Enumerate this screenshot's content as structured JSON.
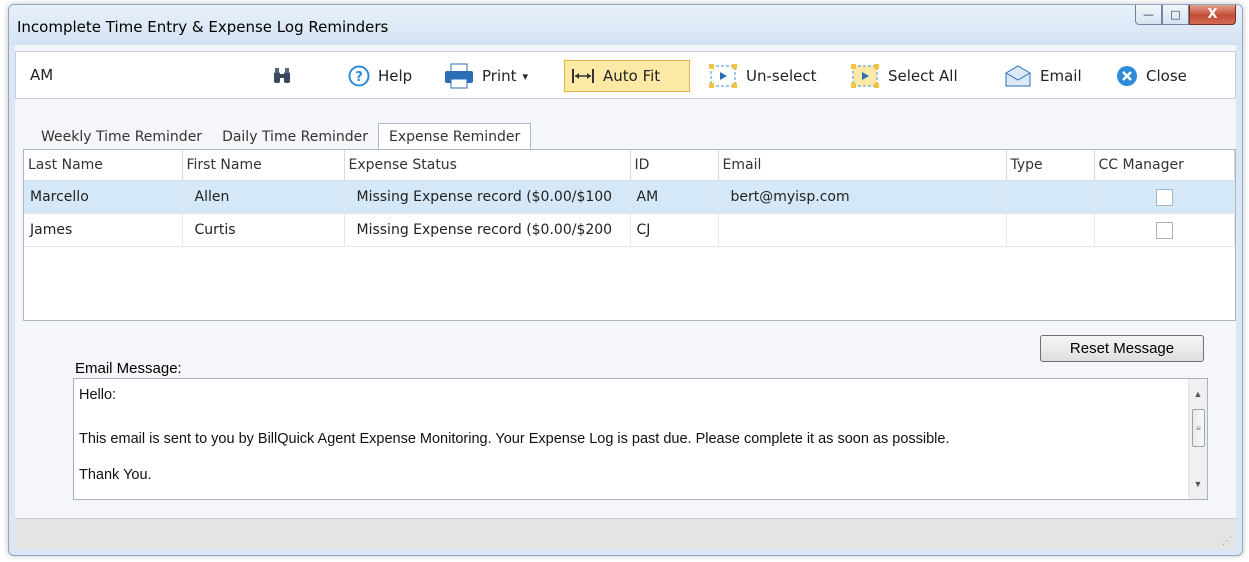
{
  "window": {
    "title": "Incomplete Time Entry & Expense Log Reminders",
    "controls": {
      "minimize": "—",
      "maximize": "□",
      "close": "X"
    }
  },
  "toolbar": {
    "search_value": "AM",
    "help_label": "Help",
    "print_label": "Print",
    "print_arrow": "▾",
    "autofit_label": "Auto Fit",
    "unselect_label": "Un-select",
    "selectall_label": "Select All",
    "email_label": "Email",
    "close_label": "Close"
  },
  "tabs": [
    "Weekly Time Reminder",
    "Daily Time Reminder",
    "Expense Reminder"
  ],
  "grid": {
    "columns": [
      "Last Name",
      "First Name",
      "Expense Status",
      "ID",
      "Email",
      "Type",
      "CC Manager"
    ],
    "rows": [
      {
        "last": "Marcello",
        "first": "Allen",
        "status": "Missing Expense record ($0.00/$100",
        "id": "AM",
        "email": "bert@myisp.com",
        "type": "",
        "cc": false
      },
      {
        "last": "James",
        "first": "Curtis",
        "status": "Missing Expense record ($0.00/$200",
        "id": "CJ",
        "email": "",
        "type": "",
        "cc": false
      }
    ]
  },
  "email": {
    "reset_label": "Reset Message",
    "label": "Email Message:",
    "lines": [
      "Hello:",
      "This email is sent to you by BillQuick Agent Expense Monitoring. Your Expense Log is past due. Please complete it as soon as possible.",
      "Thank You."
    ]
  },
  "colors": {
    "selected_row": "#d5e8f7",
    "active_button": "#fde9a6",
    "title_bar": "#dbe7f5"
  }
}
